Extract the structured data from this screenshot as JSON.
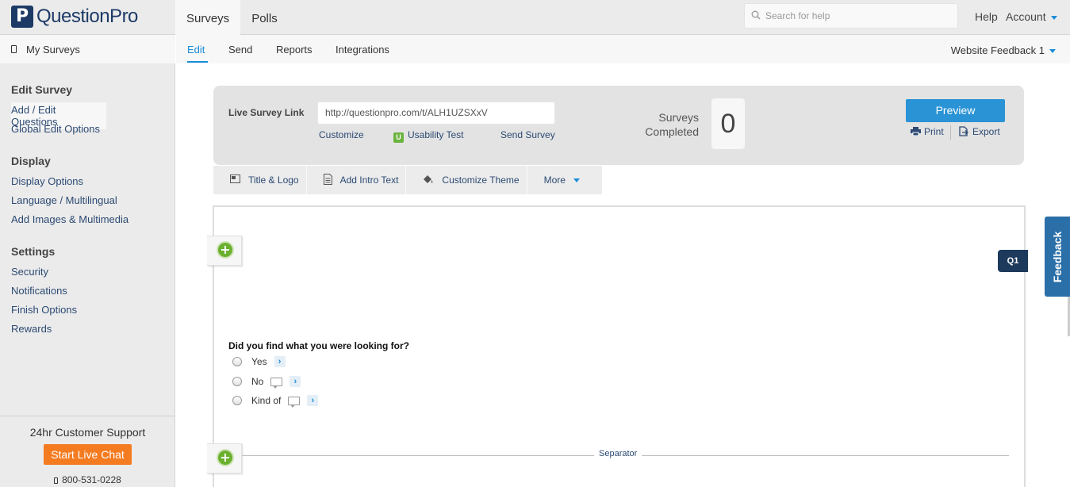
{
  "app": {
    "logo_mark": "P",
    "logo_text": "QuestionPro"
  },
  "topbar": {
    "tabs": [
      {
        "label": "Surveys"
      },
      {
        "label": "Polls"
      }
    ],
    "search_placeholder": "Search for help",
    "help_label": "Help",
    "account_label": "Account"
  },
  "subnav": {
    "tabs": [
      {
        "label": "Edit"
      },
      {
        "label": "Send"
      },
      {
        "label": "Reports"
      },
      {
        "label": "Integrations"
      }
    ],
    "survey_name": "Website Feedback 1"
  },
  "sidebar": {
    "my_surveys": "My Surveys",
    "sections": [
      {
        "title": "Edit Survey",
        "items": [
          "Add / Edit Questions",
          "Global Edit Options"
        ]
      },
      {
        "title": "Display",
        "items": [
          "Display Options",
          "Language / Multilingual",
          "Add Images & Multimedia"
        ]
      },
      {
        "title": "Settings",
        "items": [
          "Security",
          "Notifications",
          "Finish Options",
          "Rewards"
        ]
      }
    ],
    "support": {
      "title": "24hr Customer Support",
      "chat_button": "Start Live Chat",
      "phone": "800-531-0228"
    }
  },
  "link_panel": {
    "label": "Live Survey Link",
    "url": "http://questionpro.com/t/ALH1UZSXxV",
    "customize": "Customize",
    "usability_badge": "U",
    "usability": "Usability Test",
    "send": "Send Survey",
    "completed_line1": "Surveys",
    "completed_line2": "Completed",
    "completed_count": "0",
    "preview": "Preview",
    "print": "Print",
    "export": "Export"
  },
  "toolbar": {
    "title_logo": "Title & Logo",
    "intro_text": "Add Intro Text",
    "theme": "Customize Theme",
    "more": "More"
  },
  "survey": {
    "question_badge": "Q1",
    "question": "Did you find what you were looking for?",
    "answers": [
      "Yes",
      "No",
      "Kind of"
    ],
    "separator": "Separator"
  },
  "feedback_tab": "Feedback",
  "colors": {
    "brand": "#1d3a66",
    "accent": "#1a8cd8",
    "chat": "#f47b20",
    "add": "#6bb02f",
    "feedback": "#2b6fa8"
  }
}
